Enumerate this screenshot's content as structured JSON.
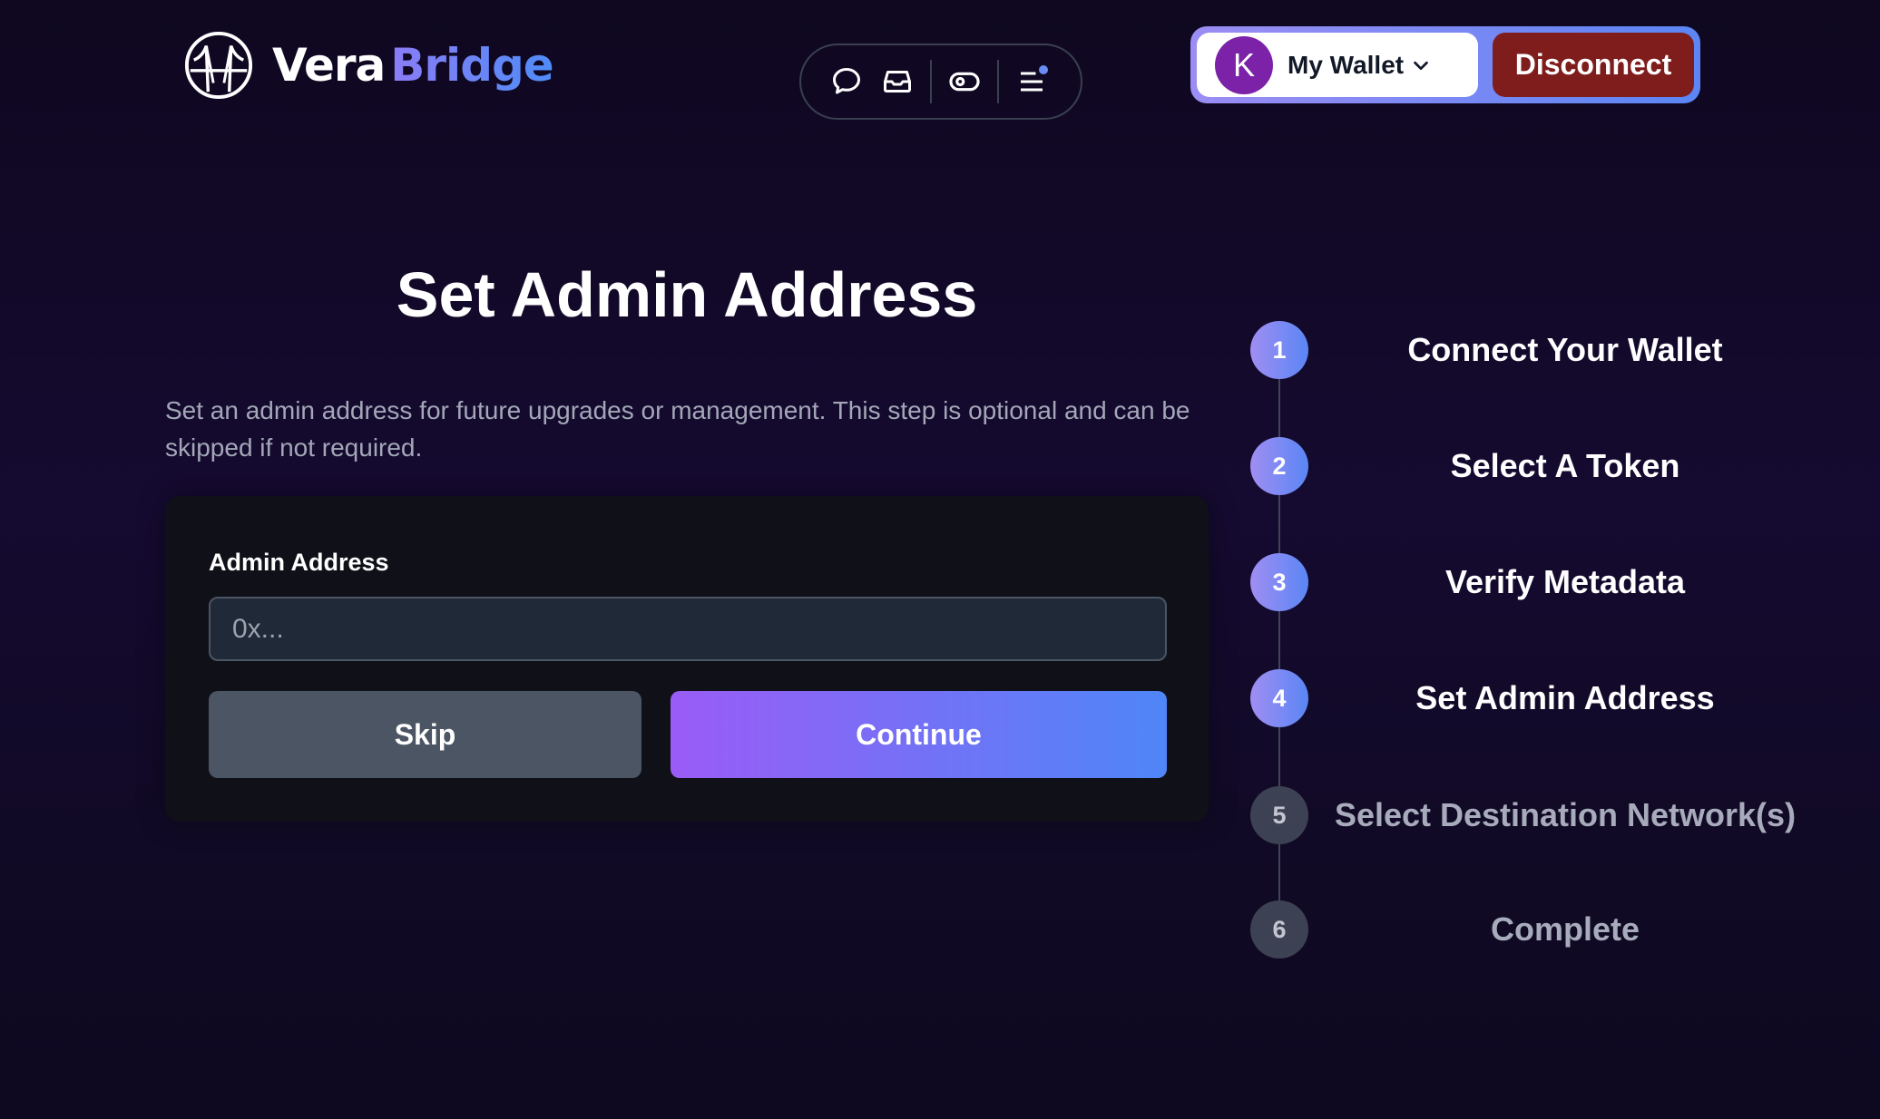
{
  "brand": {
    "name_part1": "Vera",
    "name_part2": "Bridge",
    "logo_icon": "bridge-logo-icon"
  },
  "nav": {
    "icons": [
      "chat-bubble-icon",
      "inbox-tray-icon",
      "eye-toggle-icon",
      "menu-icon"
    ],
    "menu_has_notification": true,
    "notification_color": "#6a8cf5"
  },
  "wallet": {
    "avatar_letter": "K",
    "label": "My Wallet",
    "disconnect_label": "Disconnect",
    "avatar_color": "#7c22a8",
    "disconnect_color": "#7f1d1d"
  },
  "page": {
    "title": "Set Admin Address",
    "description": "Set an admin address for future upgrades or management. This step is optional and can be skipped if not required."
  },
  "form": {
    "field_label": "Admin Address",
    "field_value": "",
    "field_placeholder": "0x...",
    "skip_label": "Skip",
    "continue_label": "Continue"
  },
  "stepper": {
    "current_step": 4,
    "steps": [
      {
        "number": "1",
        "label": "Connect Your Wallet",
        "state": "active"
      },
      {
        "number": "2",
        "label": "Select A Token",
        "state": "active"
      },
      {
        "number": "3",
        "label": "Verify Metadata",
        "state": "active"
      },
      {
        "number": "4",
        "label": "Set Admin Address",
        "state": "active"
      },
      {
        "number": "5",
        "label": "Select Destination Network(s)",
        "state": "inactive"
      },
      {
        "number": "6",
        "label": "Complete",
        "state": "inactive"
      }
    ]
  }
}
